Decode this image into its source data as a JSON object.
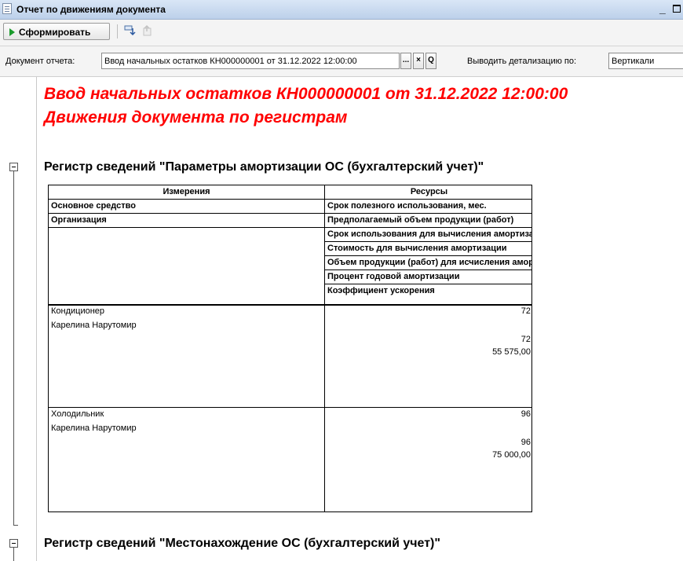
{
  "window": {
    "title": "Отчет по движениям документа",
    "minimize": "_"
  },
  "toolbar": {
    "generate_label": "Сформировать"
  },
  "params": {
    "doc_label": "Документ отчета:",
    "doc_value": "Ввод начальных остатков КН000000001 от 31.12.2022 12:00:00",
    "ellipsis": "...",
    "clear": "×",
    "open": "Q",
    "detail_label": "Выводить детализацию по:",
    "detail_value": "Вертикали"
  },
  "report": {
    "title1": "Ввод начальных остатков КН000000001 от 31.12.2022 12:00:00",
    "title2": "Движения документа по регистрам",
    "section1": {
      "title": "Регистр сведений \"Параметры амортизации ОС (бухгалтерский учет)\"",
      "headers": [
        "Измерения",
        "Ресурсы"
      ],
      "dimensions": [
        "Основное средство",
        "Организация"
      ],
      "resources": [
        "Срок полезного использования, мес.",
        "Предполагаемый объем продукции (работ)",
        "Срок использования для вычисления амортизации",
        "Стоимость для вычисления амортизации",
        "Объем продукции (работ) для исчисления амортизации",
        "Процент годовой амортизации",
        "Коэффициент ускорения"
      ],
      "rows": [
        {
          "asset": "Кондиционер",
          "org": "Карелина Нарутомир",
          "useful_life": "72",
          "usage_term": "72",
          "cost": "55 575,00"
        },
        {
          "asset": "Холодильник",
          "org": "Карелина Нарутомир",
          "useful_life": "96",
          "usage_term": "96",
          "cost": "75 000,00"
        }
      ]
    },
    "section2": {
      "title": "Регистр сведений \"Местонахождение ОС (бухгалтерский учет)\""
    }
  }
}
